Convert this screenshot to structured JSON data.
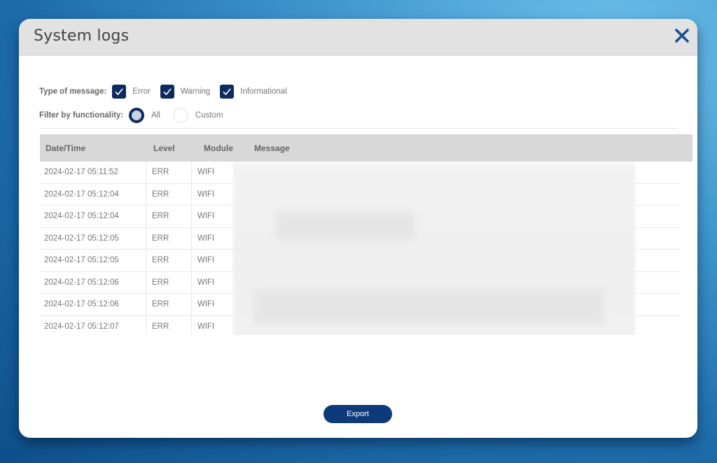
{
  "modal": {
    "title": "System logs",
    "close_icon": "close-x-icon"
  },
  "filters": {
    "type_label": "Type of message:",
    "types": [
      {
        "label": "Error",
        "checked": true
      },
      {
        "label": "Warning",
        "checked": true
      },
      {
        "label": "Informational",
        "checked": true
      }
    ],
    "functionality_label": "Filter by functionality:",
    "functionality_options": [
      {
        "label": "All",
        "selected": true
      },
      {
        "label": "Custom",
        "selected": false
      }
    ]
  },
  "table": {
    "headers": [
      "Date/Time",
      "Level",
      "Module",
      "Message"
    ],
    "rows": [
      {
        "datetime": "2024-02-17 05:11:52",
        "level": "ERR",
        "module": "WIFI",
        "message": ""
      },
      {
        "datetime": "2024-02-17 05:12:04",
        "level": "ERR",
        "module": "WIFI",
        "message": ""
      },
      {
        "datetime": "2024-02-17 05:12:04",
        "level": "ERR",
        "module": "WIFI",
        "message": ""
      },
      {
        "datetime": "2024-02-17 05:12:05",
        "level": "ERR",
        "module": "WIFI",
        "message": ""
      },
      {
        "datetime": "2024-02-17 05:12:05",
        "level": "ERR",
        "module": "WIFI",
        "message": ""
      },
      {
        "datetime": "2024-02-17 05:12:06",
        "level": "ERR",
        "module": "WIFI",
        "message": ""
      },
      {
        "datetime": "2024-02-17 05:12:06",
        "level": "ERR",
        "module": "WIFI",
        "message": ""
      },
      {
        "datetime": "2024-02-17 05:12:07",
        "level": "ERR",
        "module": "WIFI",
        "message": ""
      }
    ]
  },
  "actions": {
    "export_label": "Export"
  },
  "colors": {
    "accent": "#0d2b5e",
    "button": "#0d3a7a",
    "close_icon": "#1a4f8f",
    "header_bg": "#e2e2e2",
    "table_header_bg": "#d8d8d8"
  }
}
